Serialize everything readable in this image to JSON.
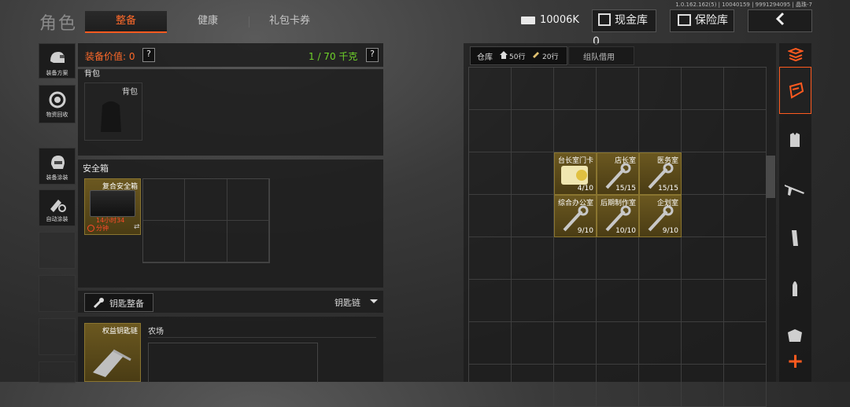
{
  "version_text": "1.0.162.162(5) | 10040159 | 9991294095 | 晶珠-7",
  "header": {
    "title": "角色",
    "tabs": [
      {
        "label": "整备",
        "active": true
      },
      {
        "label": "健康",
        "active": false
      },
      {
        "label": "礼包卡券",
        "active": false
      }
    ],
    "money": "10006K",
    "cash_vault": "现金库 0",
    "insurance": "保险库"
  },
  "side_buttons": [
    {
      "label": "装备方案",
      "icon": "helmet-icon"
    },
    {
      "label": "物资回收",
      "icon": "recycle-icon"
    },
    {
      "label": "装备涂装",
      "icon": "paint-helmet-icon"
    },
    {
      "label": "自动涂装",
      "icon": "auto-paint-icon"
    }
  ],
  "equip": {
    "value_label": "装备价值: 0",
    "weight": "1 / 70 千克",
    "help": "?"
  },
  "backpack": {
    "section": "背包",
    "slot_label": "背包"
  },
  "safe_box": {
    "section": "安全箱",
    "item_name": "复合安全箱",
    "timer_line1": "14小时34",
    "timer_line2": "分钟",
    "swap_glyph": "⇄"
  },
  "keys": {
    "button": "钥匙整备",
    "chain_label": "钥匙链",
    "item_name": "权益钥匙链",
    "location": "农场"
  },
  "warehouse": {
    "tab_main": "仓库",
    "rows_a": "50行",
    "rows_b": "20行",
    "tab_team": "组队借用",
    "items": [
      {
        "name": "台长室门卡",
        "count": "4/10",
        "kind": "card"
      },
      {
        "name": "店长室",
        "count": "15/15",
        "kind": "key"
      },
      {
        "name": "医务室",
        "count": "15/15",
        "kind": "key"
      },
      {
        "name": "综合办公室",
        "count": "9/10",
        "kind": "key"
      },
      {
        "name": "后期制作室",
        "count": "10/10",
        "kind": "key"
      },
      {
        "name": "企划室",
        "count": "9/10",
        "kind": "key"
      }
    ]
  },
  "right_tabs": [
    "sort-icon",
    "backpack-icon",
    "armor-vest-icon",
    "rifle-icon",
    "magazine-icon",
    "bullet-icon",
    "chest-rig-icon"
  ],
  "add_glyph": "+",
  "colors": {
    "accent": "#ff5a1f",
    "weight_green": "#6fd32a",
    "item_gold": "#6b5820",
    "timer_red": "#ff4a2a"
  }
}
